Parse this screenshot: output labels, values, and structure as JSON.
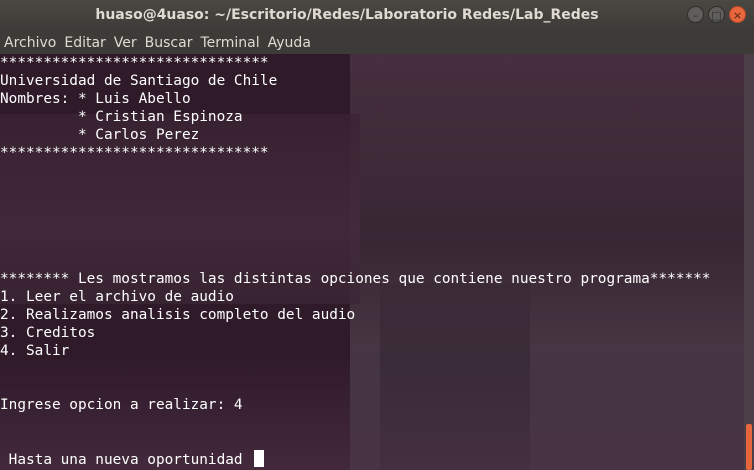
{
  "window": {
    "title": "huaso@4uaso: ~/Escritorio/Redes/Laboratorio Redes/Lab_Redes",
    "buttons": {
      "minimize": "–",
      "maximize": "□",
      "close": "×"
    }
  },
  "menubar": {
    "items": [
      "Archivo",
      "Editar",
      "Ver",
      "Buscar",
      "Terminal",
      "Ayuda"
    ]
  },
  "terminal": {
    "lines": [
      "*******************************",
      "Universidad de Santiago de Chile",
      "Nombres: * Luis Abello",
      "         * Cristian Espinoza",
      "         * Carlos Perez",
      "*******************************",
      "",
      "",
      "",
      "",
      "",
      "",
      "******** Les mostramos las distintas opciones que contiene nuestro programa*******",
      "1. Leer el archivo de audio",
      "2. Realizamos analisis completo del audio",
      "3. Creditos",
      "4. Salir",
      "",
      "",
      "Ingrese opcion a realizar: 4",
      "",
      "",
      " Hasta una nueva oportunidad "
    ]
  },
  "colors": {
    "accent": "#e8663b",
    "terminal_bg": "#2f1a2a",
    "text": "#ffffff"
  }
}
